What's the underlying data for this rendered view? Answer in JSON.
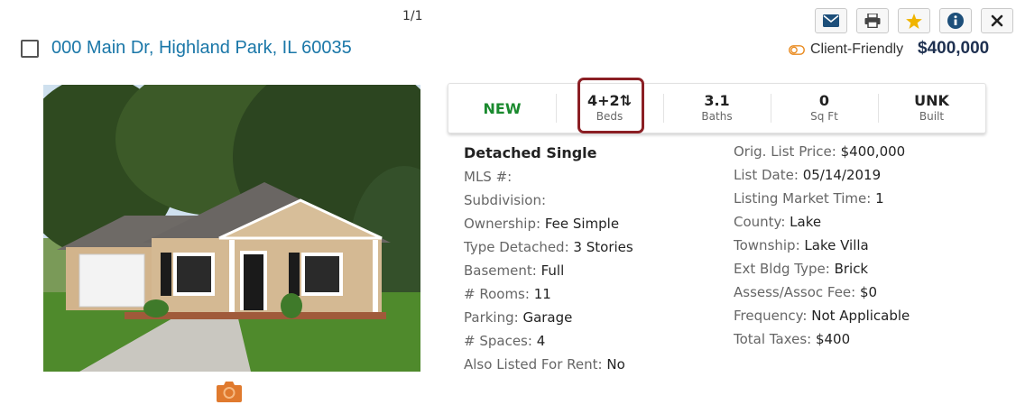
{
  "header": {
    "counter": "1/1",
    "address": "000 Main Dr, Highland Park, IL 60035",
    "client_friendly_label": "Client-Friendly",
    "price": "$400,000",
    "toolbar": [
      "envelope-icon",
      "print-icon",
      "star-icon",
      "info-icon",
      "close-icon"
    ]
  },
  "photo": {
    "alt": "single story house",
    "camera_badge": "1"
  },
  "stats": {
    "status": "NEW",
    "beds_value": "4+2",
    "beds_label": "Beds",
    "baths_value": "3.1",
    "baths_label": "Baths",
    "sqft_value": "0",
    "sqft_label": "Sq Ft",
    "built_value": "UNK",
    "built_label": "Built"
  },
  "details": {
    "property_type": "Detached Single",
    "left": [
      {
        "label": "MLS #:",
        "value": ""
      },
      {
        "label": "Subdivision:",
        "value": ""
      },
      {
        "label": "Ownership:",
        "value": "Fee Simple"
      },
      {
        "label": "Type Detached:",
        "value": "3 Stories"
      },
      {
        "label": "Basement:",
        "value": "Full"
      },
      {
        "label": "# Rooms:",
        "value": "11"
      },
      {
        "label": "Parking:",
        "value": "Garage"
      },
      {
        "label": "# Spaces:",
        "value": "4"
      },
      {
        "label": "Also Listed For Rent:",
        "value": "No"
      }
    ],
    "right": [
      {
        "label": "Orig. List Price:",
        "value": "$400,000"
      },
      {
        "label": "List Date:",
        "value": "05/14/2019"
      },
      {
        "label": "Listing Market Time:",
        "value": "1"
      },
      {
        "label": "County:",
        "value": "Lake"
      },
      {
        "label": "Township:",
        "value": "Lake Villa"
      },
      {
        "label": "Ext Bldg Type:",
        "value": "Brick"
      },
      {
        "label": "Assess/Assoc Fee:",
        "value": "$0"
      },
      {
        "label": "Frequency:",
        "value": "Not Applicable"
      },
      {
        "label": "Total Taxes:",
        "value": "$400"
      }
    ]
  },
  "colors": {
    "link": "#1a77a8",
    "price": "#1e3050",
    "new": "#1a8a2e",
    "highlight": "#8b1f24",
    "star": "#f0b400",
    "camera": "#e07a2e"
  }
}
